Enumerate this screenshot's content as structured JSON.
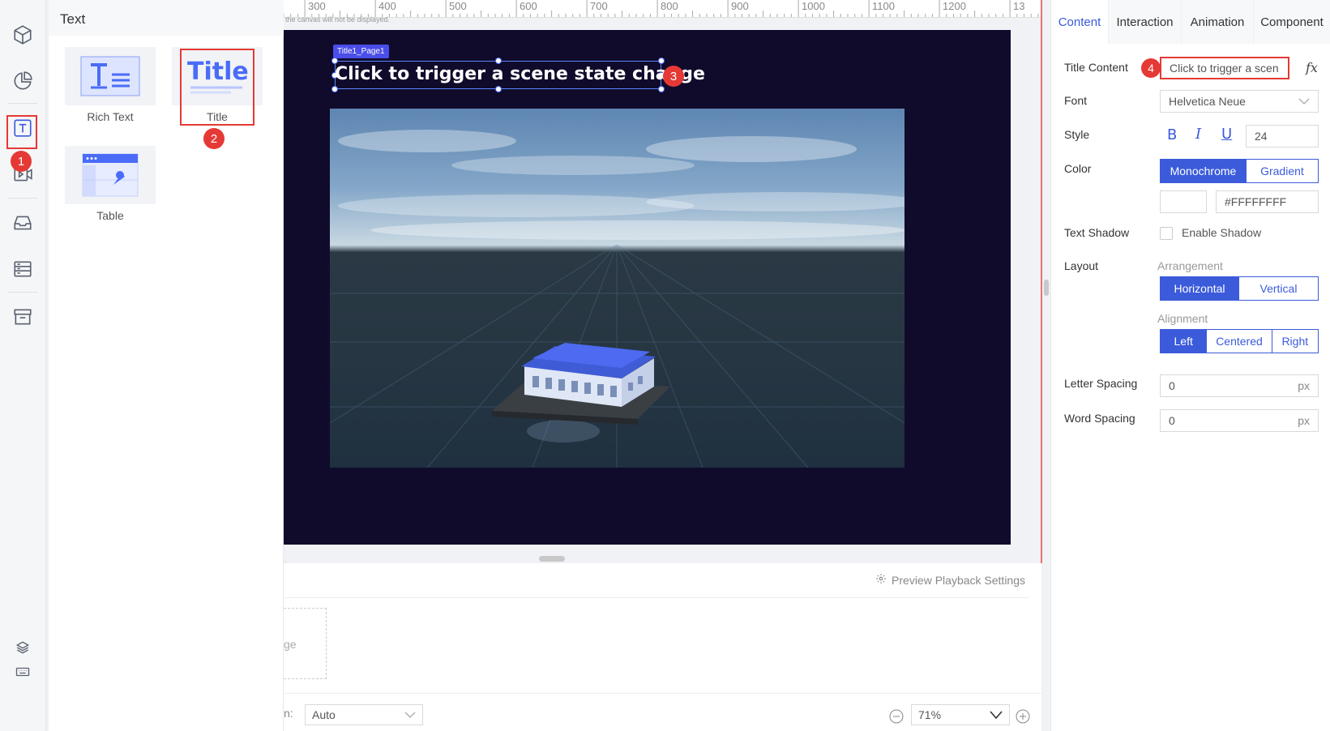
{
  "component_panel": {
    "title": "Text",
    "items": [
      {
        "label": "Rich Text"
      },
      {
        "label": "Title"
      },
      {
        "label": "Table"
      }
    ]
  },
  "annotations": [
    "1",
    "2",
    "3",
    "4"
  ],
  "ruler": {
    "labels": [
      "300",
      "400",
      "500",
      "600",
      "700",
      "800",
      "900",
      "1000",
      "1100",
      "1200",
      "13"
    ]
  },
  "canvas": {
    "hint": "the canvas will not be displayed.",
    "tag": "Title1_Page1",
    "title_text": "Click to trigger a scene state change"
  },
  "bottom": {
    "preview_settings": "Preview Playback Settings",
    "dashed_text": "ge",
    "colon_text": "n:",
    "select_value": "Auto",
    "zoom_value": "71%"
  },
  "right_panel": {
    "tabs": [
      "Content",
      "Interaction",
      "Animation",
      "Component"
    ],
    "title_content_label": "Title Content",
    "title_content_value": "Click to trigger a scen",
    "fx_label": "fx",
    "font_label": "Font",
    "font_value": "Helvetica Neue",
    "style_label": "Style",
    "style_bold": "B",
    "style_italic": "I",
    "style_underline": "U",
    "font_size": "24",
    "color_label": "Color",
    "color_modes": [
      "Monochrome",
      "Gradient"
    ],
    "color_hex": "#FFFFFFFF",
    "shadow_label": "Text Shadow",
    "shadow_option": "Enable Shadow",
    "layout_label": "Layout",
    "arrangement_label": "Arrangement",
    "arrangement_options": [
      "Horizontal",
      "Vertical"
    ],
    "alignment_label": "Alignment",
    "alignment_options": [
      "Left",
      "Centered",
      "Right"
    ],
    "letter_spacing_label": "Letter Spacing",
    "letter_spacing_value": "0",
    "word_spacing_label": "Word Spacing",
    "word_spacing_value": "0",
    "unit": "px"
  },
  "colors": {
    "accent": "#3b5bdb",
    "annotation_red": "#e53935",
    "screen_bg": "#100b2b"
  }
}
